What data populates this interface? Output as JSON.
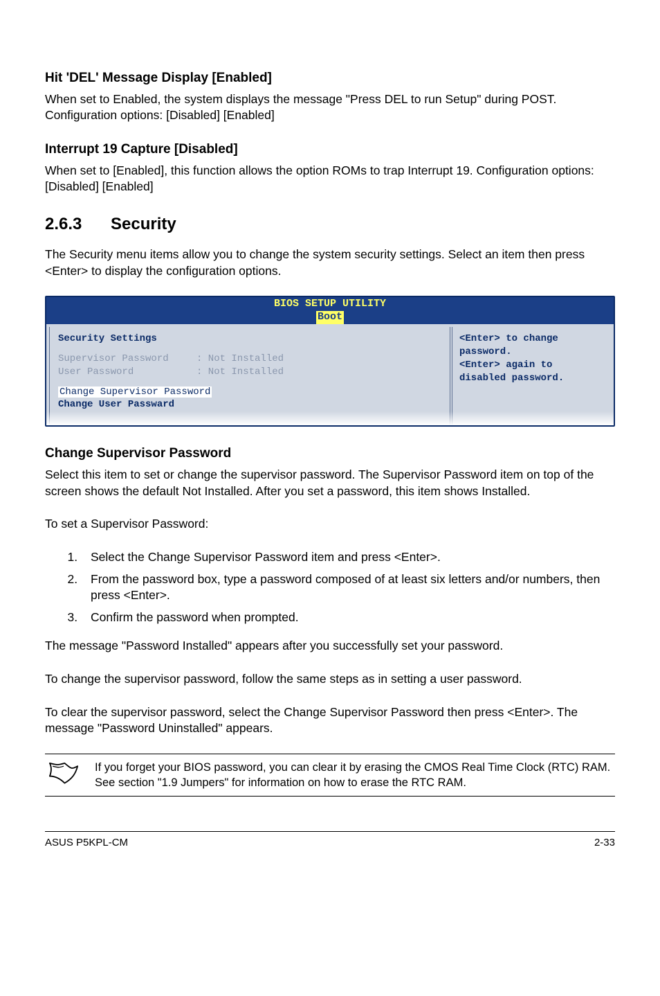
{
  "sec1": {
    "heading": "Hit 'DEL' Message Display [Enabled]",
    "text": "When set to Enabled, the system displays the message \"Press DEL to run Setup\" during POST. Configuration options: [Disabled] [Enabled]"
  },
  "sec2": {
    "heading": "Interrupt 19 Capture [Disabled]",
    "text": "When set to [Enabled], this function allows the option ROMs to trap Interrupt 19. Configuration options: [Disabled] [Enabled]"
  },
  "section_header": {
    "num": "2.6.3",
    "title": "Security"
  },
  "section_intro": "The Security menu items allow you to change the system security settings. Select an item then press <Enter> to display the configuration options.",
  "bios": {
    "header_line1": "BIOS SETUP UTILITY",
    "header_tab": "Boot",
    "left_title": "Security Settings",
    "rows": [
      {
        "label": "Supervisor Password",
        "value": ": Not Installed"
      },
      {
        "label": "User Password",
        "value": ": Not Installed"
      }
    ],
    "selected": "Change Supervisor Password",
    "below_selected": "Change User Passward",
    "help": [
      "<Enter> to change",
      "password.",
      "<Enter> again to",
      "disabled password."
    ]
  },
  "csp": {
    "heading": "Change Supervisor Password",
    "p1": "Select this item to set or change the supervisor password. The Supervisor Password item on top of the screen shows the default Not Installed. After you set a password, this item shows Installed.",
    "p2": "To set a Supervisor Password:",
    "steps": [
      "Select the Change Supervisor Password item and press <Enter>.",
      "From the password box, type a password composed of at least six letters and/or numbers, then press <Enter>.",
      "Confirm the password when prompted."
    ],
    "p3": "The message \"Password Installed\" appears after you successfully set your password.",
    "p4": "To change the supervisor password, follow the same steps as in setting a user password.",
    "p5": "To clear the supervisor password, select the Change Supervisor Password then press <Enter>. The message \"Password Uninstalled\" appears."
  },
  "note": "If you forget your BIOS password, you can clear it by erasing the CMOS Real Time Clock (RTC) RAM. See section \"1.9 Jumpers\" for information on how to erase the RTC RAM.",
  "footer": {
    "left": "ASUS P5KPL-CM",
    "right": "2-33"
  }
}
